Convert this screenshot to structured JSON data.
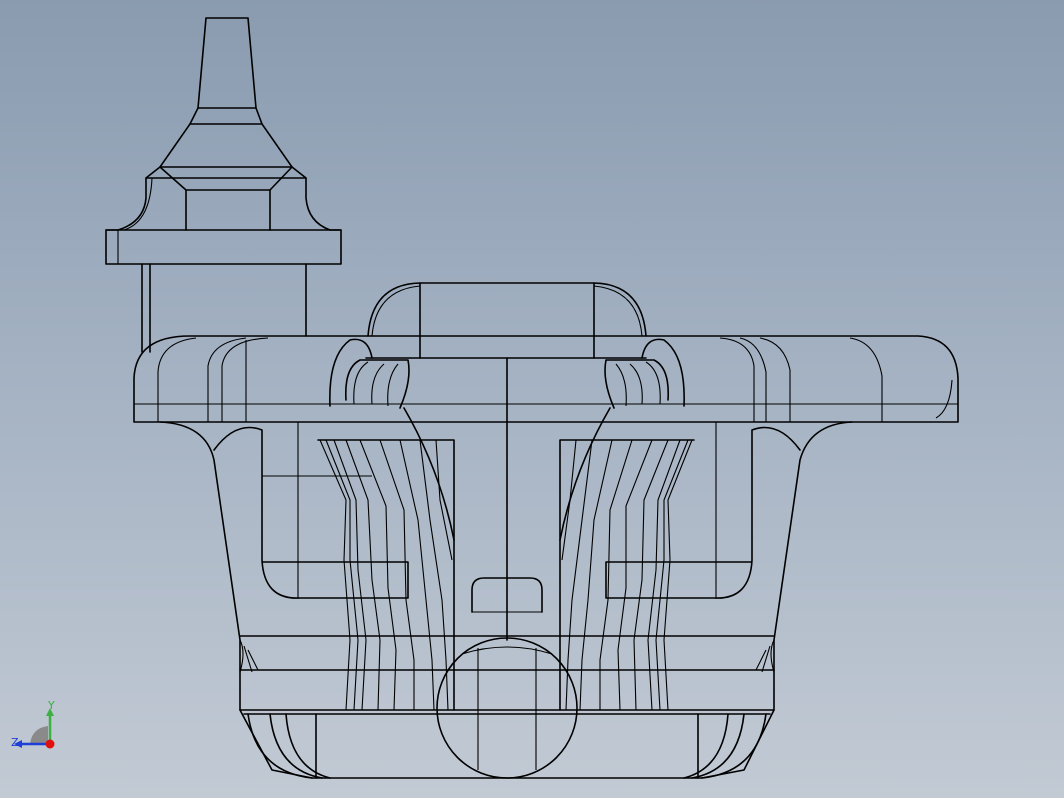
{
  "viewport": {
    "background_top": "#8a9bb0",
    "background_bottom": "#c2cad4"
  },
  "triad": {
    "y_label": "Y",
    "z_label": "Z",
    "y_color": "#3cb043",
    "z_color": "#1f3fd6",
    "x_color": "#e01010"
  }
}
